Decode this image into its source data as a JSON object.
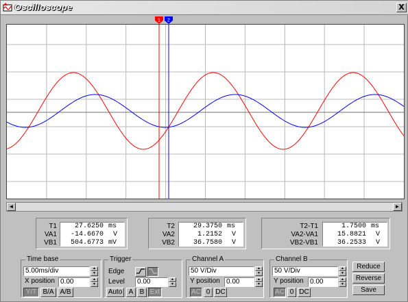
{
  "window": {
    "title": "Oscilloscope",
    "close_label": "X"
  },
  "colors": {
    "channel_a": "#ff0000",
    "channel_b": "#0000ff",
    "grid": "#b8b8b8",
    "t1": "#ff0000",
    "t2": "#0000ff"
  },
  "cursors": {
    "t1_label": "1",
    "t2_label": "2"
  },
  "scrollbar": {
    "left": "◄",
    "right": "►"
  },
  "readouts": {
    "t1": {
      "rows": [
        {
          "label": "T1",
          "value": "27.6250",
          "unit": "ms"
        },
        {
          "label": "VA1",
          "value": "-14.6670",
          "unit": "V"
        },
        {
          "label": "VB1",
          "value": "504.6773",
          "unit": "mV"
        }
      ]
    },
    "t2": {
      "rows": [
        {
          "label": "T2",
          "value": "29.3750",
          "unit": "ms"
        },
        {
          "label": "VA2",
          "value": "1.2152",
          "unit": "V"
        },
        {
          "label": "VB2",
          "value": "36.7580",
          "unit": "V"
        }
      ]
    },
    "diff": {
      "rows": [
        {
          "label": "T2-T1",
          "value": "1.7500",
          "unit": "ms"
        },
        {
          "label": "VA2-VA1",
          "value": "15.8821",
          "unit": "V"
        },
        {
          "label": "VB2-VB1",
          "value": "36.2533",
          "unit": "V"
        }
      ]
    }
  },
  "timebase": {
    "title": "Time base",
    "value": "5.00ms/div",
    "xpos_label": "X position",
    "xpos_value": "0.00",
    "modes": [
      "Y/T",
      "B/A",
      "A/B"
    ],
    "active_mode": "Y/T"
  },
  "trigger": {
    "title": "Trigger",
    "edge_label": "Edge",
    "level_label": "Level",
    "level_value": "0.00",
    "sources": [
      "Auto",
      "A",
      "B",
      "Ext"
    ]
  },
  "channel_a": {
    "title": "Channel A",
    "scale": "50 V/Div",
    "ypos_label": "Y position",
    "ypos_value": "0.00",
    "coupling": [
      "AC",
      "0",
      "DC"
    ],
    "active": "AC"
  },
  "channel_b": {
    "title": "Channel B",
    "scale": "50 V/Div",
    "ypos_label": "Y position",
    "ypos_value": "0.00",
    "coupling": [
      "AC",
      "0",
      "DC"
    ],
    "active": "AC"
  },
  "side_buttons": [
    "Reduce",
    "Reverse",
    "Save"
  ]
}
